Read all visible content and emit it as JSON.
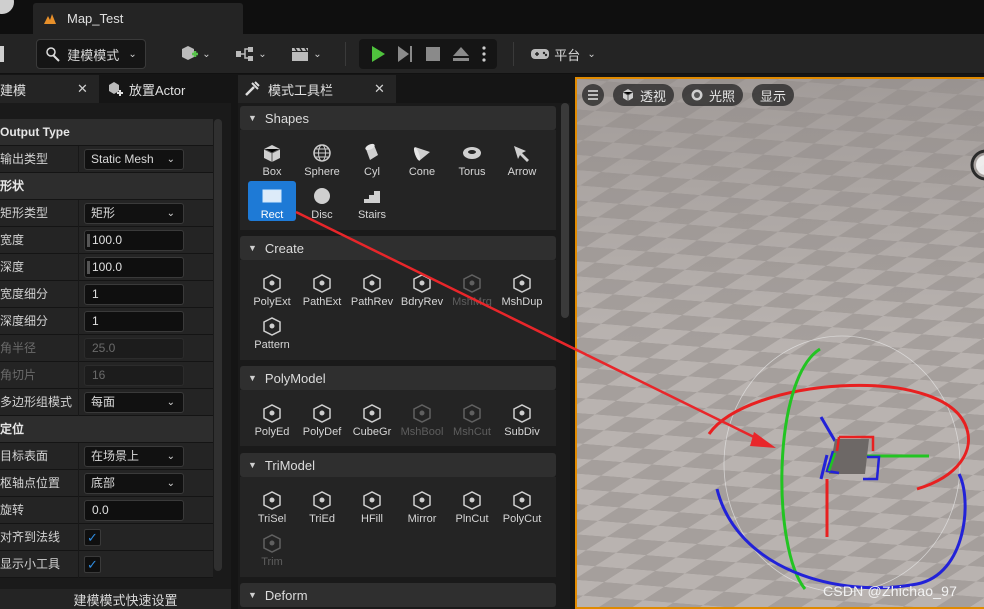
{
  "window": {
    "tab_title": "Map_Test"
  },
  "toolbar": {
    "mode_label": "建模模式",
    "platform_label": "平台"
  },
  "left_panel": {
    "tabs": [
      {
        "label": "建模"
      },
      {
        "label": "放置Actor"
      }
    ],
    "rows": [
      {
        "type": "category",
        "label": "Output Type"
      },
      {
        "type": "combo",
        "label": "输出类型",
        "value": "Static Mesh"
      },
      {
        "type": "category",
        "label": "形状"
      },
      {
        "type": "combo",
        "label": "矩形类型",
        "value": "矩形"
      },
      {
        "type": "number",
        "label": "宽度",
        "value": "100.0"
      },
      {
        "type": "number",
        "label": "深度",
        "value": "100.0"
      },
      {
        "type": "number",
        "label": "宽度细分",
        "value": "1"
      },
      {
        "type": "number",
        "label": "深度细分",
        "value": "1"
      },
      {
        "type": "number-disabled",
        "label": "角半径",
        "value": "25.0"
      },
      {
        "type": "number-disabled",
        "label": "角切片",
        "value": "16"
      },
      {
        "type": "combo",
        "label": "多边形组模式",
        "value": "每面"
      },
      {
        "type": "category",
        "label": "定位"
      },
      {
        "type": "combo",
        "label": "目标表面",
        "value": "在场景上"
      },
      {
        "type": "combo",
        "label": "枢轴点位置",
        "value": "底部"
      },
      {
        "type": "number",
        "label": "旋转",
        "value": "0.0"
      },
      {
        "type": "check",
        "label": "对齐到法线",
        "value": "✓"
      },
      {
        "type": "check",
        "label": "显示小工具",
        "value": "✓"
      }
    ],
    "footer": "建模模式快速设置"
  },
  "mid_panel": {
    "tab_label": "模式工具栏",
    "sections": [
      {
        "name": "Shapes",
        "tools": [
          "Box",
          "Sphere",
          "Cyl",
          "Cone",
          "Torus",
          "Arrow",
          "Rect",
          "Disc",
          "Stairs"
        ]
      },
      {
        "name": "Create",
        "tools": [
          "PolyExt",
          "PathExt",
          "PathRev",
          "BdryRev",
          "MshMrg",
          "MshDup",
          "Pattern"
        ]
      },
      {
        "name": "PolyModel",
        "tools": [
          "PolyEd",
          "PolyDef",
          "CubeGr",
          "MshBool",
          "MshCut",
          "SubDiv"
        ]
      },
      {
        "name": "TriModel",
        "tools": [
          "TriSel",
          "TriEd",
          "HFill",
          "Mirror",
          "PlnCut",
          "PolyCut",
          "Trim"
        ]
      },
      {
        "name": "Deform",
        "tools": []
      }
    ]
  },
  "viewport": {
    "perspective_label": "透视",
    "lighting_label": "光照",
    "show_label": "显示"
  },
  "watermark": "CSDN @Zhichao_97",
  "colors": {
    "accent": "#1e7ad6",
    "viewport_border": "#e08a00",
    "annotation_arrow": "#e8262a"
  }
}
